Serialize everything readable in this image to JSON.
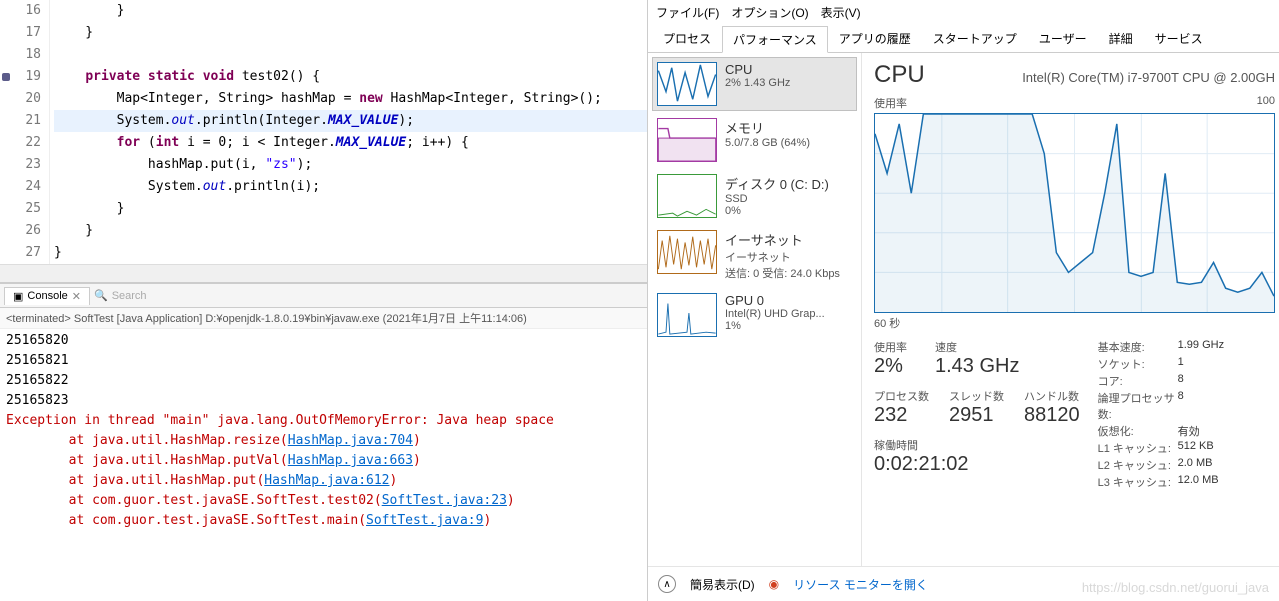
{
  "editor": {
    "lines": [
      {
        "n": 16,
        "html": "        }"
      },
      {
        "n": 17,
        "html": "    }"
      },
      {
        "n": 18,
        "html": ""
      },
      {
        "n": 19,
        "mark": true,
        "html": "    <span class='kw'>private static void</span> test02() {"
      },
      {
        "n": 20,
        "html": "        Map&lt;Integer, String&gt; hashMap = <span class='kw'>new</span> HashMap&lt;Integer, String&gt;();"
      },
      {
        "n": 21,
        "hl": true,
        "html": "        System.<span class='field'>out</span>.println(Integer.<span class='const'>MAX_VALUE</span>);"
      },
      {
        "n": 22,
        "html": "        <span class='kw'>for</span> (<span class='kw'>int</span> i = 0; i &lt; Integer.<span class='const'>MAX_VALUE</span>; i++) {"
      },
      {
        "n": 23,
        "html": "            hashMap.put(i, <span class='str'>\"zs\"</span>);"
      },
      {
        "n": 24,
        "html": "            System.<span class='field'>out</span>.println(i);"
      },
      {
        "n": 25,
        "html": "        }"
      },
      {
        "n": 26,
        "html": "    }"
      },
      {
        "n": 27,
        "html": "}"
      }
    ]
  },
  "console": {
    "tab_label": "Console",
    "search_placeholder": "Search",
    "status": "<terminated> SoftTest [Java Application] D:¥openjdk-1.8.0.19¥bin¥javaw.exe (2021年1月7日 上午11:14:06)",
    "lines": [
      {
        "cls": "out",
        "t": "25165820"
      },
      {
        "cls": "out",
        "t": "25165821"
      },
      {
        "cls": "out",
        "t": "25165822"
      },
      {
        "cls": "out",
        "t": "25165823"
      },
      {
        "cls": "err",
        "html": "Exception in thread \"main\" java.lang.OutOfMemoryError: Java heap space"
      },
      {
        "cls": "err",
        "html": "&nbsp;&nbsp;&nbsp;&nbsp;&nbsp;&nbsp;&nbsp;&nbsp;at java.util.HashMap.resize(<a>HashMap.java:704</a>)"
      },
      {
        "cls": "err",
        "html": "&nbsp;&nbsp;&nbsp;&nbsp;&nbsp;&nbsp;&nbsp;&nbsp;at java.util.HashMap.putVal(<a>HashMap.java:663</a>)"
      },
      {
        "cls": "err",
        "html": "&nbsp;&nbsp;&nbsp;&nbsp;&nbsp;&nbsp;&nbsp;&nbsp;at java.util.HashMap.put(<a>HashMap.java:612</a>)"
      },
      {
        "cls": "err",
        "html": "&nbsp;&nbsp;&nbsp;&nbsp;&nbsp;&nbsp;&nbsp;&nbsp;at com.guor.test.javaSE.SoftTest.test02(<a>SoftTest.java:23</a>)"
      },
      {
        "cls": "err",
        "html": "&nbsp;&nbsp;&nbsp;&nbsp;&nbsp;&nbsp;&nbsp;&nbsp;at com.guor.test.javaSE.SoftTest.main(<a>SoftTest.java:9</a>)"
      }
    ]
  },
  "tm": {
    "menu": [
      "ファイル(F)",
      "オプション(O)",
      "表示(V)"
    ],
    "tabs": [
      "プロセス",
      "パフォーマンス",
      "アプリの履歴",
      "スタートアップ",
      "ユーザー",
      "詳細",
      "サービス"
    ],
    "active_tab": 1,
    "sidebar": [
      {
        "title": "CPU",
        "sub": "2%  1.43 GHz",
        "color": "#1a6fb0",
        "active": true
      },
      {
        "title": "メモリ",
        "sub": "5.0/7.8 GB (64%)",
        "color": "#a33aa3"
      },
      {
        "title": "ディスク 0 (C: D:)",
        "sub": "SSD\n0%",
        "color": "#3a9a3a"
      },
      {
        "title": "イーサネット",
        "sub": "イーサネット\n送信: 0 受信: 24.0 Kbps",
        "color": "#b06a1a"
      },
      {
        "title": "GPU 0",
        "sub": "Intel(R) UHD Grap...\n1%",
        "color": "#1a6fb0"
      }
    ],
    "main": {
      "title": "CPU",
      "cpu_name": "Intel(R) Core(TM) i7-9700T CPU @ 2.00GH",
      "chart_top_left": "使用率",
      "chart_top_right": "100",
      "chart_bottom": "60 秒",
      "stats_top": [
        {
          "label": "使用率",
          "value": "2%"
        },
        {
          "label": "速度",
          "value": "1.43 GHz"
        }
      ],
      "stats_bottom": [
        {
          "label": "プロセス数",
          "value": "232"
        },
        {
          "label": "スレッド数",
          "value": "2951"
        },
        {
          "label": "ハンドル数",
          "value": "88120"
        }
      ],
      "uptime_label": "稼働時間",
      "uptime_value": "0:02:21:02",
      "details": [
        {
          "k": "基本速度:",
          "v": "1.99 GHz"
        },
        {
          "k": "ソケット:",
          "v": "1"
        },
        {
          "k": "コア:",
          "v": "8"
        },
        {
          "k": "論理プロセッサ数:",
          "v": "8"
        },
        {
          "k": "仮想化:",
          "v": "有効"
        },
        {
          "k": "L1 キャッシュ:",
          "v": "512 KB"
        },
        {
          "k": "L2 キャッシュ:",
          "v": "2.0 MB"
        },
        {
          "k": "L3 キャッシュ:",
          "v": "12.0 MB"
        }
      ]
    },
    "footer": {
      "simple_view": "簡易表示(D)",
      "resource_monitor": "リソース モニターを開く"
    }
  },
  "watermark": "https://blog.csdn.net/guorui_java",
  "chart_data": {
    "type": "line",
    "title": "CPU 使用率",
    "xlabel": "60 秒",
    "ylabel": "使用率",
    "ylim": [
      0,
      100
    ],
    "values": [
      90,
      70,
      95,
      60,
      100,
      100,
      100,
      100,
      100,
      100,
      100,
      100,
      100,
      100,
      80,
      30,
      20,
      25,
      30,
      60,
      95,
      20,
      18,
      20,
      70,
      15,
      14,
      15,
      25,
      12,
      10,
      12,
      20,
      8
    ]
  }
}
